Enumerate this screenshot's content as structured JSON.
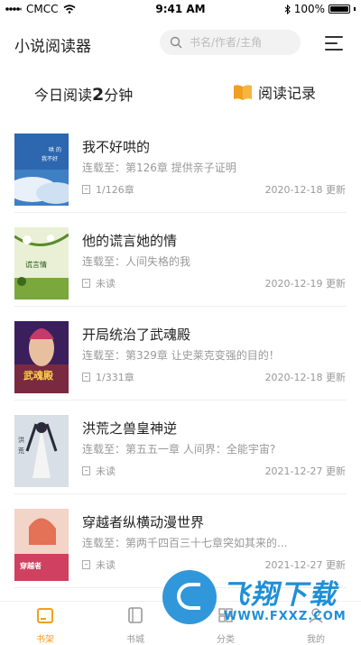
{
  "status_bar": {
    "carrier": "CMCC",
    "time": "9:41 AM",
    "battery": "100%"
  },
  "header": {
    "title": "小说阅读器",
    "search_placeholder": "书名/作者/主角"
  },
  "summary": {
    "today_prefix": "今日阅读",
    "today_minutes": "2",
    "today_suffix": "分钟",
    "history_label": "阅读记录"
  },
  "books": [
    {
      "title": "我不好哄的",
      "latest": "连载至：第126章 提供亲子证明",
      "progress": "1/126章",
      "updated": "2020-12-18 更新"
    },
    {
      "title": "他的谎言她的情",
      "latest": "连载至：人间失格的我",
      "progress": "未读",
      "updated": "2020-12-19 更新"
    },
    {
      "title": "开局统治了武魂殿",
      "latest": "连载至：第329章 让史莱克变强的目的！",
      "progress": "1/331章",
      "updated": "2020-12-18 更新"
    },
    {
      "title": "洪荒之兽皇神逆",
      "latest": "连载至：第五五一章 人间界：全能宇宙?",
      "progress": "未读",
      "updated": "2021-12-27 更新"
    },
    {
      "title": "穿越者纵横动漫世界",
      "latest": "连载至：第两千四百三十七章突如其来的...",
      "progress": "未读",
      "updated": "2021-12-27 更新"
    }
  ],
  "tabs": [
    {
      "label": "书架",
      "active": true
    },
    {
      "label": "书城",
      "active": false
    },
    {
      "label": "分类",
      "active": false
    },
    {
      "label": "我的",
      "active": false
    }
  ],
  "watermark": {
    "text": "飞翔下载",
    "url": "WWW.FXXZ.COM"
  },
  "colors": {
    "accent": "#f0a020",
    "watermark": "#1f8fd8"
  }
}
